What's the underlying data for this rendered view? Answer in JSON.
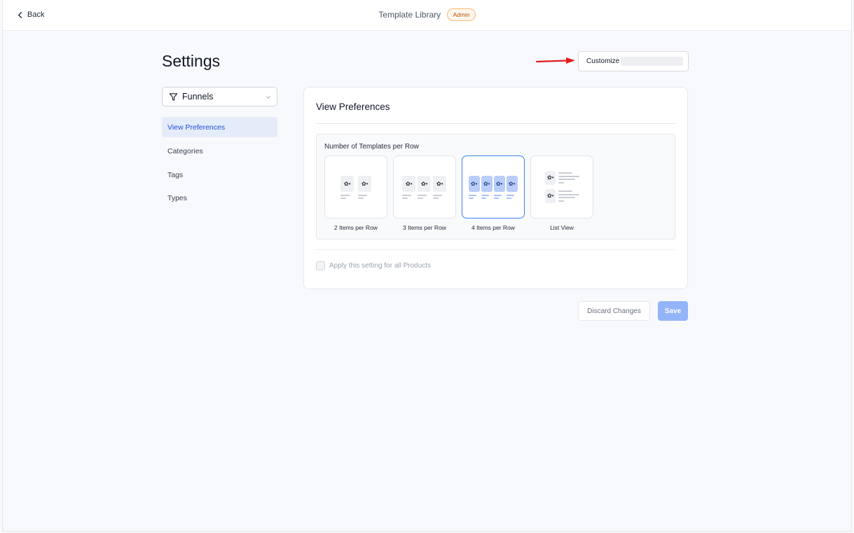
{
  "header": {
    "back_label": "Back",
    "title": "Template Library",
    "badge": "Admin"
  },
  "page": {
    "title": "Settings",
    "customize_label": "Customize"
  },
  "sidebar": {
    "select_value": "Funnels",
    "items": [
      {
        "label": "View Preferences",
        "active": true
      },
      {
        "label": "Categories",
        "active": false
      },
      {
        "label": "Tags",
        "active": false
      },
      {
        "label": "Types",
        "active": false
      }
    ]
  },
  "view_preferences": {
    "title": "View Preferences",
    "section_title": "Number of Templates per Row",
    "options": [
      {
        "label": "2 Items per Row",
        "selected": false
      },
      {
        "label": "3 Items per Row",
        "selected": false
      },
      {
        "label": "4 Items per Row",
        "selected": true
      },
      {
        "label": "List View",
        "selected": false
      }
    ],
    "apply_all_label": "Apply this setting for all Products",
    "apply_all_checked": false
  },
  "actions": {
    "discard_label": "Discard Changes",
    "save_label": "Save"
  },
  "colors": {
    "accent": "#3b82f6",
    "save_disabled": "#93b4f9",
    "badge_text": "#b45309",
    "annotation_arrow": "#e11d1d"
  }
}
